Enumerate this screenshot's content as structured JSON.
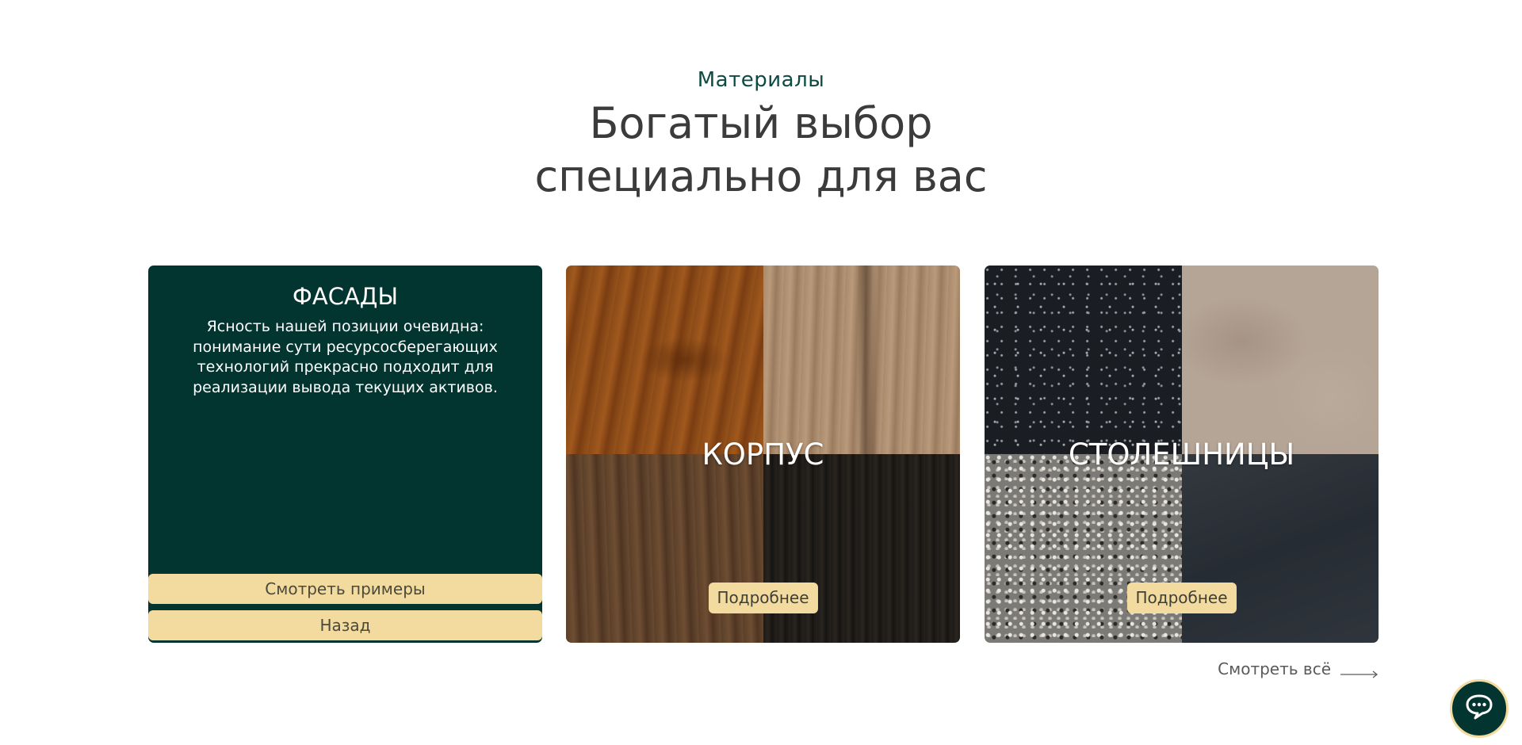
{
  "section": {
    "eyebrow": "Материалы",
    "heading_line1": "Богатый выбор",
    "heading_line2": "специально для вас"
  },
  "cards": [
    {
      "title": "ФАСАДЫ",
      "description": "Ясность нашей позиции очевидна: понимание сути ресурсосберегающих технологий прекрасно подходит для реализации вывода текущих активов.",
      "primary_button": "Смотреть примеры",
      "secondary_button": "Назад",
      "background_color": "#023430"
    },
    {
      "title": "КОРПУС",
      "button": "Подробнее",
      "texture": "wood"
    },
    {
      "title": "СТОЛЕШНИЦЫ",
      "button": "Подробнее",
      "texture": "stone"
    }
  ],
  "see_all": {
    "label": "Смотреть всё",
    "icon": "arrow-right-icon"
  },
  "chat": {
    "icon": "chat-bubble-icon"
  },
  "colors": {
    "accent": "#f3dba0",
    "brand_dark": "#023430",
    "eyebrow": "#0d4a44",
    "heading": "#3b3b3b"
  }
}
